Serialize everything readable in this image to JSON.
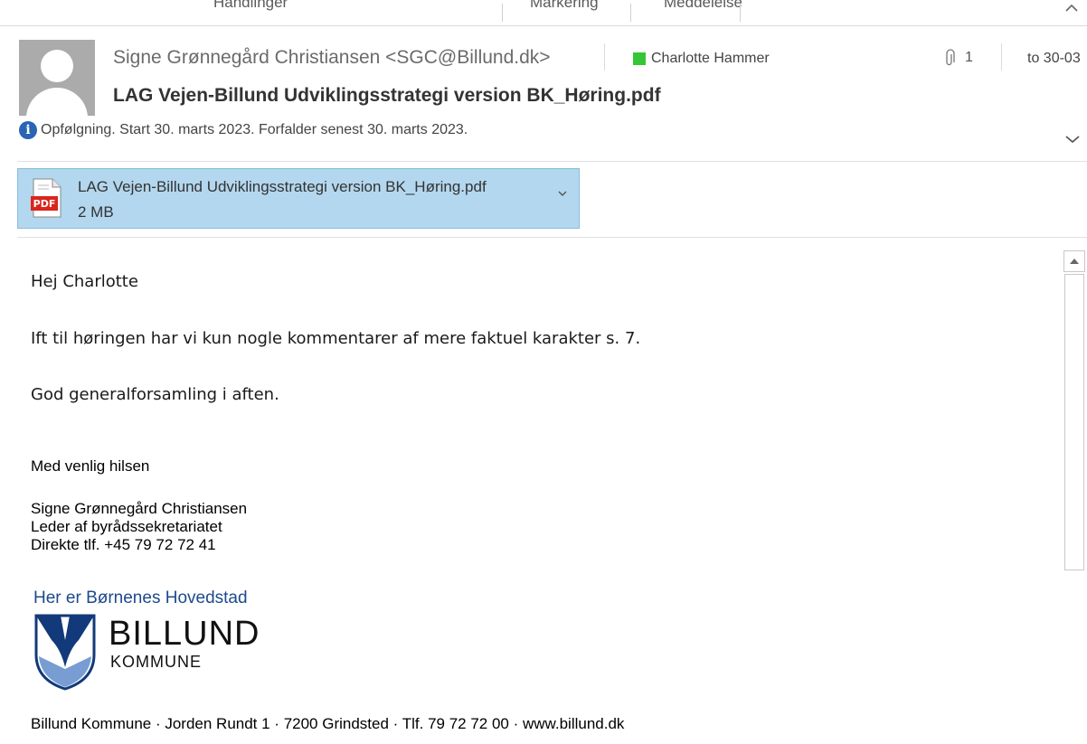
{
  "ribbon": {
    "groups": [
      "Handlinger",
      "Markering",
      "Meddelelse"
    ]
  },
  "message": {
    "sender": "Signe Grønnegård Christiansen <SGC@Billund.dk>",
    "recipient": "Charlotte Hammer",
    "attachment_count": "1",
    "date": "to 30-03",
    "subject": "LAG Vejen-Billund Udviklingsstrategi version BK_Høring.pdf",
    "followup": "Opfølgning.  Start 30. marts 2023.  Forfalder senest 30. marts 2023.",
    "category_color": "#35c635"
  },
  "attachment": {
    "icon_label": "PDF",
    "name": "LAG Vejen-Billund Udviklingsstrategi version BK_Høring.pdf",
    "size": "2 MB"
  },
  "body": {
    "greeting": "Hej Charlotte",
    "line1": "Ift til høringen har vi kun nogle kommentarer af mere faktuel karakter s. 7.",
    "line2": "God generalforsamling i aften.",
    "closing": "Med venlig hilsen"
  },
  "signature": {
    "name": "Signe Grønnegård Christiansen",
    "title": "Leder af byrådssekretariatet",
    "phone": "Direkte tlf. +45 79 72 72 41",
    "tagline": "Her er Børnenes Hovedstad",
    "logo_name": "BILLUND",
    "logo_sub": "KOMMUNE",
    "footer": "Billund Kommune · Jorden Rundt 1 · 7200 Grindsted · Tlf. 79 72 72 00 · www.billund.dk"
  },
  "icons": {
    "avatar": "person-avatar",
    "attachment": "paperclip-icon",
    "info": "info-icon",
    "expand": "chevron-down-icon",
    "scroll_up": "arrow-up-icon"
  }
}
